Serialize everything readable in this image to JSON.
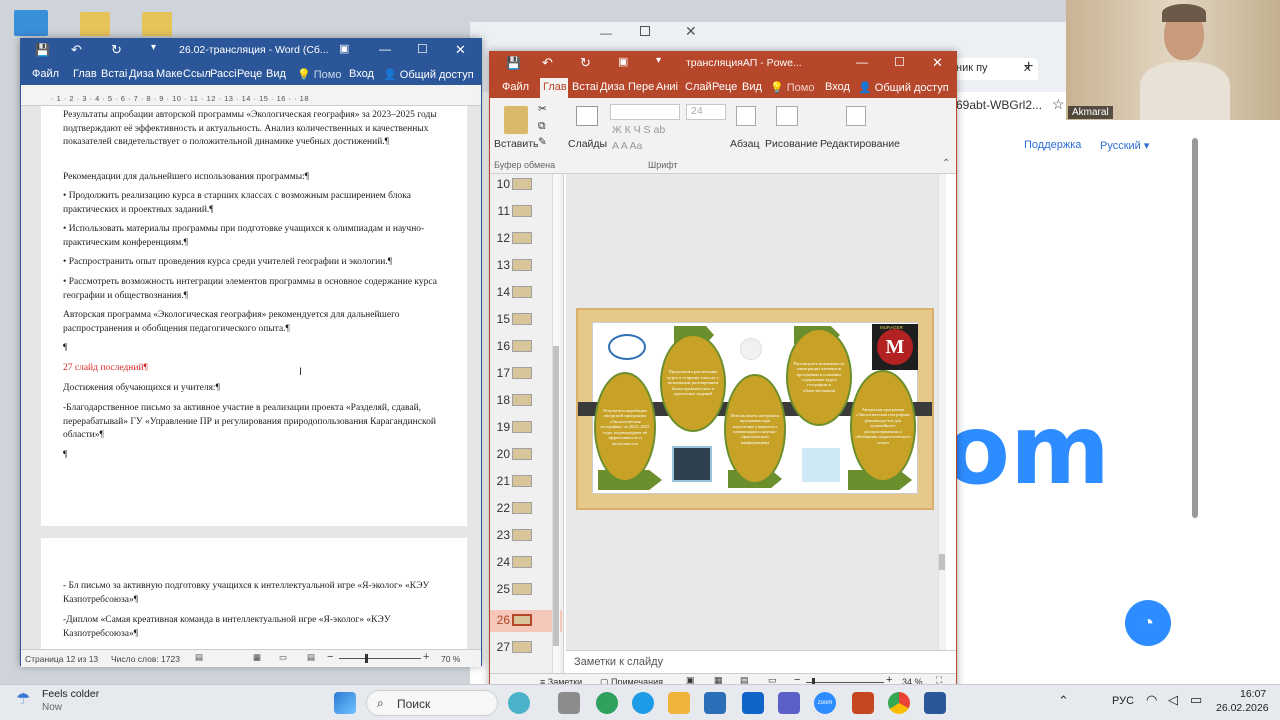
{
  "word": {
    "title": "26.02-трансляция - Word (Сб...",
    "tabs": [
      "Файл",
      "Глав",
      "Встаі",
      "Диза",
      "Маке",
      "Ссыл",
      "Рассі",
      "Реце",
      "Вид"
    ],
    "help": "Помо",
    "signin": "Вход",
    "share": "Общий доступ",
    "ruler": "· 1 · 2 · 3 · 4 · 5 · 6 · 7 · 8 · 9 · 10 · 11 · 12 · 13 · 14 · 15 · 16 · · 18",
    "paragraphs": [
      "Результаты апробации авторской программы «Экологическая география» за 2023–2025 годы подтверждают её эффективность и актуальность. Анализ количественных и качественных показателей свидетельствует о положительной динамике учебных достижений.¶",
      "Рекомендации для дальнейшего использования программы:¶",
      "• Продолжить реализацию курса в старших классах с возможным расширением блока практических и проектных заданий.¶",
      "• Использовать материалы программы при подготовке учащихся к олимпиадам и научно-практическим конференциям.¶",
      "• Распространить опыт проведения курса среди учителей географии и экологии.¶",
      "• Рассмотреть возможность интеграции элементов программы в основное содержание курса географии и обществознания.¶",
      "Авторская программа «Экологическая география» рекомендуется для дальнейшего распространения и обобщения педагогического опыта.¶",
      "¶",
      "27 слайд последний¶",
      "Достижения обучающихся и учителя:¶",
      "-Благодарственное письмо за активное участие в реализации проекта «Разделяй, сдавай, перерабатывай» ГУ «Управление ПР и регулирования природопользования Карагандинской области»¶",
      "¶"
    ],
    "page2": [
      "- Бл письмо за активную подготовку учащихся к интеллектуальной игре «Я-эколог» «КЭУ Казпотребсоюза»¶",
      "-Диплом «Самая креативная команда в интеллектуальной игре «Я-эколог» «КЭУ Казпотребсоюза»¶"
    ],
    "status": {
      "page": "Страница 12 из 13",
      "words": "Число слов: 1723",
      "zoom": "70 %"
    }
  },
  "ppt": {
    "title": "трансляцияАП - Powe...",
    "tabs": [
      "Файл",
      "Глав",
      "Встаі",
      "Диза",
      "Пере",
      "Аниі",
      "Слай",
      "Реце",
      "Вид"
    ],
    "help": "Помо",
    "signin": "Вход",
    "share": "Общий доступ",
    "ribbon": {
      "paste": "Вставить",
      "slides": "Слайды",
      "paragraph": "Абзац",
      "drawing": "Рисование",
      "editing": "Редактирование",
      "clipboard": "Буфер обмена",
      "font": "Шрифт",
      "font_size": "24"
    },
    "slide_numbers": [
      "10",
      "11",
      "12",
      "13",
      "14",
      "15",
      "16",
      "17",
      "18",
      "19",
      "20",
      "21",
      "22",
      "23",
      "24",
      "25",
      "26",
      "27"
    ],
    "selected_slide": "26",
    "slide": {
      "oval_texts": [
        "Результаты апробации авторской программы «Экологическая география» за 2023–2025 годы подтверждают её эффективность и актуальность",
        "Продолжить реализацию курса в старших классах с возможным расширением блока практических и проектных заданий",
        "Использовать материалы программы при подготовке учащихся к олимпиадам и научно-практическим конференциям",
        "Рассмотреть возможность интеграции элементов программы в основное содержание курса географии и обществознания",
        "Авторская программа «Экологическая география» рекомендуется для дальнейшего распространения и обобщения педагогического опыта"
      ],
      "logo_text": "M",
      "logo_caption": "MURAGER"
    },
    "notes": "Заметки к слайду",
    "status": {
      "notes_btn": "Заметки",
      "comments_btn": "Примечания",
      "zoom": "34 %"
    }
  },
  "browser": {
    "tab_fragment": "ник пу",
    "url_fragment": "69abt-WBGrl2...",
    "support": "Поддержка",
    "language": "Русский",
    "zoom_fragment": "om"
  },
  "camera": {
    "name": "Akmaral"
  },
  "taskbar": {
    "weather_title": "Feels colder",
    "weather_sub": "Now",
    "search": "Поиск",
    "lang": "РУС",
    "time": "16:07",
    "date": "26.02.2026",
    "zoom_label": "zoom"
  },
  "colors": {
    "word": "#2b579a",
    "ppt": "#b7472a",
    "oval": "#c8a227",
    "arrow": "#6a8f2c",
    "zoom": "#2d8cff"
  }
}
